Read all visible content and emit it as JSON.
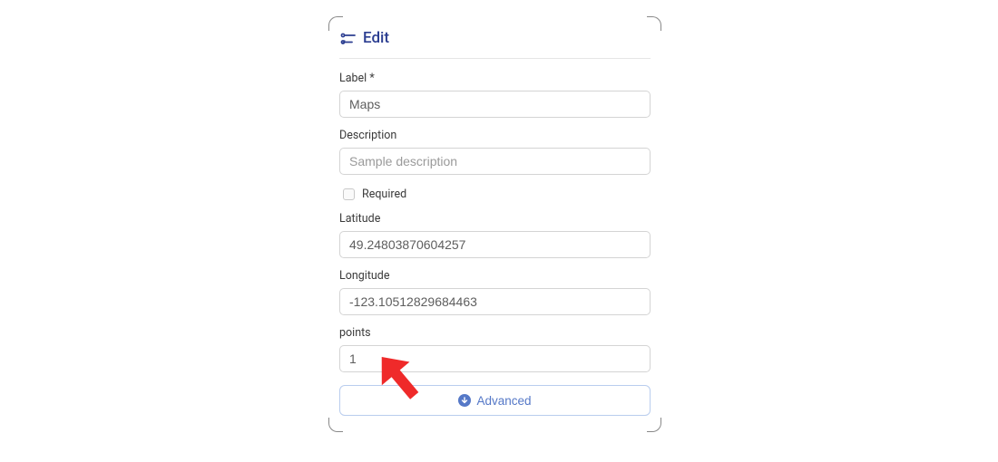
{
  "header": {
    "title": "Edit"
  },
  "fields": {
    "label": {
      "label": "Label *",
      "value": "Maps"
    },
    "description": {
      "label": "Description",
      "placeholder": "Sample description",
      "value": ""
    },
    "required": {
      "label": "Required"
    },
    "latitude": {
      "label": "Latitude",
      "value": "49.24803870604257"
    },
    "longitude": {
      "label": "Longitude",
      "value": "-123.10512829684463"
    },
    "points": {
      "label": "points",
      "value": "1"
    }
  },
  "advanced": {
    "label": "Advanced"
  }
}
